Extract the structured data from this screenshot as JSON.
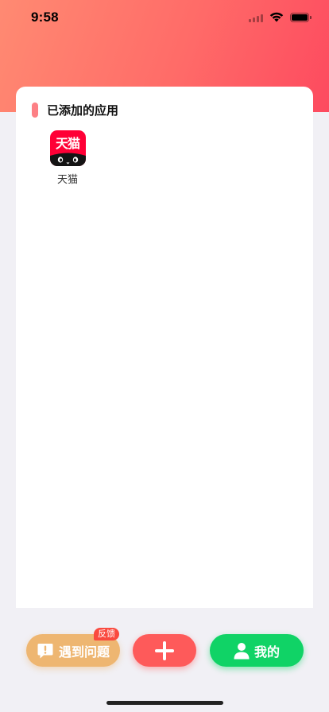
{
  "status_bar": {
    "time": "9:58"
  },
  "section": {
    "title": "已添加的应用"
  },
  "apps": [
    {
      "icon_text": "天猫",
      "label": "天猫",
      "icon": "tmall-app-icon"
    }
  ],
  "bottom_bar": {
    "feedback_label": "遇到问题",
    "feedback_badge": "反馈",
    "add_icon": "plus-icon",
    "mine_label": "我的"
  },
  "colors": {
    "header_gradient_start": "#ff8a72",
    "header_gradient_end": "#fd4a5f",
    "section_marker": "#fd8085",
    "feedback_button": "#eeb671",
    "add_button": "#fe5a5a",
    "mine_button": "#10d366",
    "tmall_red": "#ff0036"
  }
}
